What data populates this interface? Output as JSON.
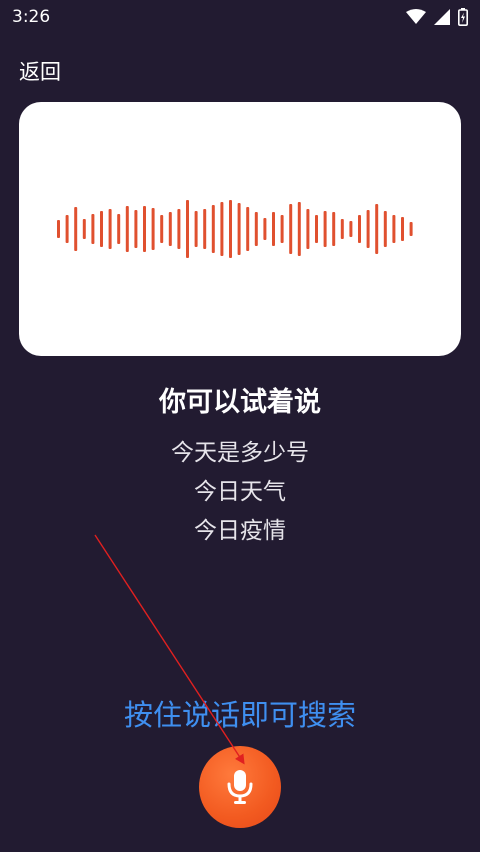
{
  "status_bar": {
    "time": "3:26",
    "icons": [
      "wifi-icon",
      "signal-icon",
      "battery-icon"
    ]
  },
  "header": {
    "back_label": "返回"
  },
  "prompt": {
    "title": "你可以试着说",
    "suggestions": [
      "今天是多少号",
      "今日天气",
      "今日疫情"
    ]
  },
  "hint": "按住说话即可搜索",
  "mic_button": {
    "icon": "microphone-icon"
  },
  "colors": {
    "background": "#221b31",
    "wave": "#e0502f",
    "hint": "#3f8ff0",
    "mic": "#f25a20",
    "annotation_arrow": "#e02020"
  }
}
